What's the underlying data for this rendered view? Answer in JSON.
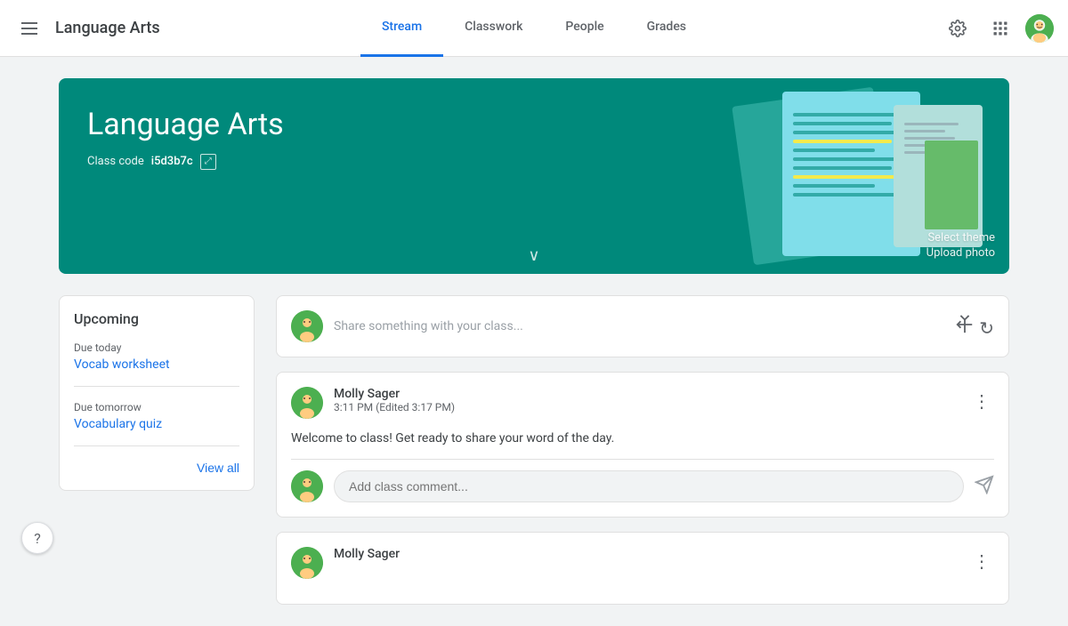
{
  "header": {
    "menu_icon": "☰",
    "title": "Language Arts",
    "nav": [
      {
        "id": "stream",
        "label": "Stream",
        "active": true
      },
      {
        "id": "classwork",
        "label": "Classwork",
        "active": false
      },
      {
        "id": "people",
        "label": "People",
        "active": false
      },
      {
        "id": "grades",
        "label": "Grades",
        "active": false
      }
    ],
    "settings_icon": "⚙",
    "apps_icon": "⋮⋮⋮"
  },
  "banner": {
    "title": "Language Arts",
    "class_code_label": "Class code",
    "class_code_value": "i5d3b7c",
    "chevron": "∨",
    "select_theme": "Select theme",
    "upload_photo": "Upload photo"
  },
  "sidebar": {
    "upcoming_title": "Upcoming",
    "assignments": [
      {
        "due": "Due today",
        "name": "Vocab worksheet"
      },
      {
        "due": "Due tomorrow",
        "name": "Vocabulary quiz"
      }
    ],
    "view_all": "View all"
  },
  "feed": {
    "share_placeholder": "Share something with your class...",
    "posts": [
      {
        "author": "Molly Sager",
        "time": "3:11 PM (Edited 3:17 PM)",
        "body": "Welcome to class! Get ready to share your word of the day.",
        "comment_placeholder": "Add class comment..."
      },
      {
        "author": "Molly Sager",
        "time": "",
        "body": "",
        "comment_placeholder": ""
      }
    ]
  },
  "help": "?"
}
